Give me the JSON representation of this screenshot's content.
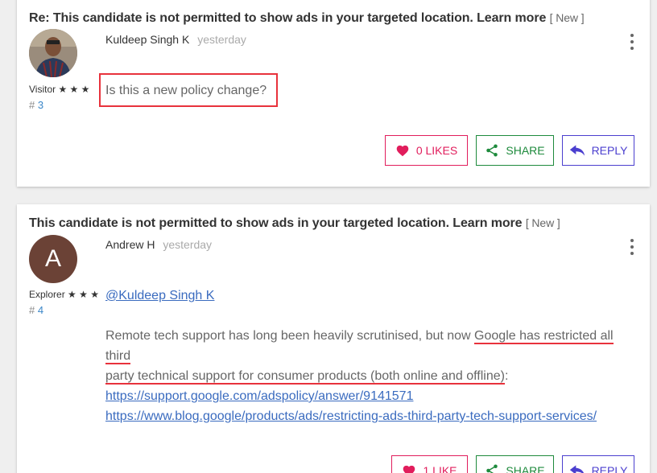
{
  "posts": [
    {
      "subject": "Re: This candidate is not permitted to show ads in your targeted location. Learn more",
      "badge": "[ New ]",
      "author": "Kuldeep Singh K",
      "time": "yesterday",
      "rank": "Visitor ★ ★ ★",
      "post_prefix": "# ",
      "post_number": "3",
      "body": "Is this a new policy change?",
      "likes_label": "0 LIKES",
      "share_label": "SHARE",
      "reply_label": "REPLY"
    },
    {
      "subject": "This candidate is not permitted to show ads in your targeted location. Learn more",
      "badge": "[ New ]",
      "author": "Andrew H",
      "avatar_letter": "A",
      "time": "yesterday",
      "rank": "Explorer ★ ★ ★",
      "post_prefix": "# ",
      "post_number": "4",
      "mention": "@Kuldeep Singh K",
      "body_part1": "Remote tech support has long been heavily scrutinised, but now ",
      "body_highlight_1": "Google has restricted all third",
      "body_highlight_2": "party technical support for consumer products (both online and offline)",
      "body_part2": ":",
      "link1": "https://support.google.com/adspolicy/answer/9141571",
      "link2": "https://www.blog.google/products/ads/restricting-ads-third-party-tech-support-services/",
      "likes_label": "1 LIKE",
      "share_label": "SHARE",
      "reply_label": "REPLY"
    }
  ],
  "colors": {
    "like": "#e11d5c",
    "share": "#1e8a3c",
    "reply": "#4b3fcf",
    "link": "#3a6bbf",
    "highlight": "#e8323c"
  }
}
